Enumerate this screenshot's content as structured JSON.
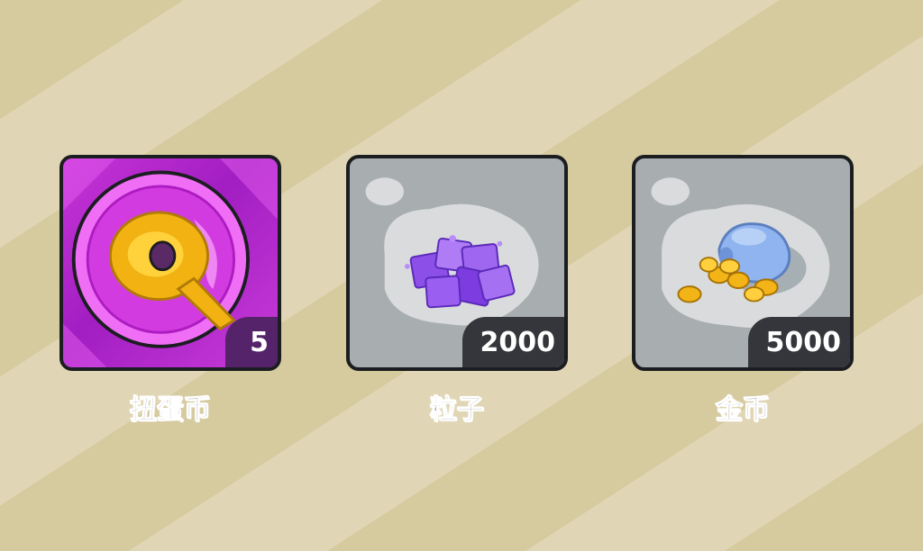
{
  "rewards": [
    {
      "name": "扭蛋币",
      "count": "5",
      "icon": "gacha-coin-icon",
      "tile_color": "#c238d6"
    },
    {
      "name": "粒子",
      "count": "2000",
      "icon": "purple-crystal-cubes-icon",
      "tile_color": "#a8aeb0"
    },
    {
      "name": "金币",
      "count": "5000",
      "icon": "gold-coin-bag-icon",
      "tile_color": "#a8aeb0"
    }
  ]
}
